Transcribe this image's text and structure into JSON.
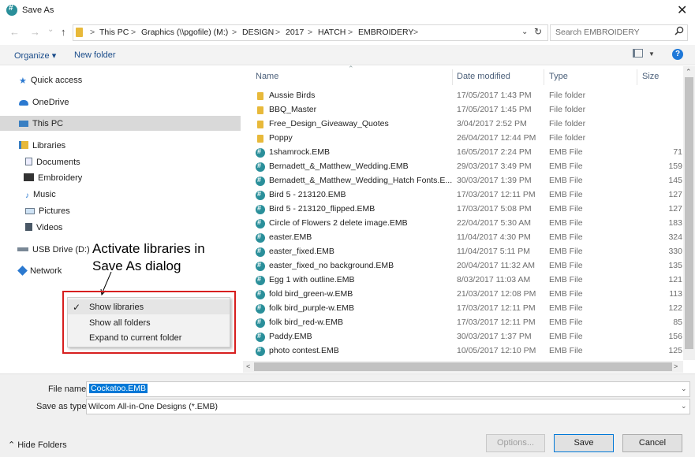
{
  "window": {
    "title": "Save As",
    "close_glyph": "✕"
  },
  "nav": {
    "back": "←",
    "forward": "→",
    "recent": "⌄",
    "up": "↑"
  },
  "address": {
    "crumbs": [
      "This PC",
      "Graphics (\\\\pgofile) (M:)",
      "DESIGN",
      "2017",
      "HATCH",
      "EMBROIDERY"
    ],
    "separator": ">",
    "dropdown": "⌄",
    "refresh": "↻"
  },
  "search": {
    "placeholder": "Search EMBROIDERY",
    "icon": "search-icon"
  },
  "toolbar": {
    "organize": "Organize ▾",
    "new_folder": "New folder",
    "view_dd": "▼",
    "help": "?"
  },
  "sidebar": {
    "items": [
      {
        "label": "Quick access",
        "icon": "star-icon"
      },
      {
        "label": "OneDrive",
        "icon": "cloud-icon"
      },
      {
        "label": "This PC",
        "icon": "pc-icon",
        "selected": true
      },
      {
        "label": "Libraries",
        "icon": "libraries-icon"
      },
      {
        "label": "Documents",
        "icon": "documents-icon"
      },
      {
        "label": "Embroidery",
        "icon": "embroidery-icon"
      },
      {
        "label": "Music",
        "icon": "music-icon"
      },
      {
        "label": "Pictures",
        "icon": "pictures-icon"
      },
      {
        "label": "Videos",
        "icon": "videos-icon"
      },
      {
        "label": "USB Drive (D:)",
        "icon": "usb-icon"
      },
      {
        "label": "Network",
        "icon": "network-icon"
      }
    ]
  },
  "annotation": {
    "text": "Activate libraries in Save As dialog"
  },
  "context_menu": {
    "check": "✓",
    "items": [
      "Show libraries",
      "Show all folders",
      "Expand to current folder"
    ]
  },
  "columns": {
    "name": "Name",
    "date": "Date modified",
    "type": "Type",
    "size": "Size",
    "sort": "⌃"
  },
  "files": [
    {
      "name": "Aussie Birds",
      "date": "17/05/2017 1:43 PM",
      "type": "File folder",
      "size": "",
      "kind": "folder"
    },
    {
      "name": "BBQ_Master",
      "date": "17/05/2017 1:45 PM",
      "type": "File folder",
      "size": "",
      "kind": "folder"
    },
    {
      "name": "Free_Design_Giveaway_Quotes",
      "date": "3/04/2017 2:52 PM",
      "type": "File folder",
      "size": "",
      "kind": "folder"
    },
    {
      "name": "Poppy",
      "date": "26/04/2017 12:44 PM",
      "type": "File folder",
      "size": "",
      "kind": "folder"
    },
    {
      "name": "1shamrock.EMB",
      "date": "16/05/2017 2:24 PM",
      "type": "EMB File",
      "size": "71",
      "kind": "emb"
    },
    {
      "name": "Bernadett_&_Matthew_Wedding.EMB",
      "date": "29/03/2017 3:49 PM",
      "type": "EMB File",
      "size": "159",
      "kind": "emb"
    },
    {
      "name": "Bernadett_&_Matthew_Wedding_Hatch Fonts.E...",
      "date": "30/03/2017 1:39 PM",
      "type": "EMB File",
      "size": "145",
      "kind": "emb"
    },
    {
      "name": "Bird 5 - 213120.EMB",
      "date": "17/03/2017 12:11 PM",
      "type": "EMB File",
      "size": "127",
      "kind": "emb"
    },
    {
      "name": "Bird 5 - 213120_flipped.EMB",
      "date": "17/03/2017 5:08 PM",
      "type": "EMB File",
      "size": "127",
      "kind": "emb"
    },
    {
      "name": "Circle of Flowers 2 delete image.EMB",
      "date": "22/04/2017 5:30 AM",
      "type": "EMB File",
      "size": "183",
      "kind": "emb"
    },
    {
      "name": "easter.EMB",
      "date": "11/04/2017 4:30 PM",
      "type": "EMB File",
      "size": "324",
      "kind": "emb"
    },
    {
      "name": "easter_fixed.EMB",
      "date": "11/04/2017 5:11 PM",
      "type": "EMB File",
      "size": "330",
      "kind": "emb"
    },
    {
      "name": "easter_fixed_no background.EMB",
      "date": "20/04/2017 11:32 AM",
      "type": "EMB File",
      "size": "135",
      "kind": "emb"
    },
    {
      "name": "Egg 1 with outline.EMB",
      "date": "8/03/2017 11:03 AM",
      "type": "EMB File",
      "size": "121",
      "kind": "emb"
    },
    {
      "name": "fold bird_green-w.EMB",
      "date": "21/03/2017 12:08 PM",
      "type": "EMB File",
      "size": "113",
      "kind": "emb"
    },
    {
      "name": "folk bird_purple-w.EMB",
      "date": "17/03/2017 12:11 PM",
      "type": "EMB File",
      "size": "122",
      "kind": "emb"
    },
    {
      "name": "folk bird_red-w.EMB",
      "date": "17/03/2017 12:11 PM",
      "type": "EMB File",
      "size": "85",
      "kind": "emb"
    },
    {
      "name": "Paddy.EMB",
      "date": "30/03/2017 1:37 PM",
      "type": "EMB File",
      "size": "156",
      "kind": "emb"
    },
    {
      "name": "photo contest.EMB",
      "date": "10/05/2017 12:10 PM",
      "type": "EMB File",
      "size": "125",
      "kind": "emb"
    }
  ],
  "form": {
    "file_name_label": "File name:",
    "file_name_value": "Cockatoo.EMB",
    "save_type_label": "Save as type:",
    "save_type_value": "Wilcom All-in-One Designs (*.EMB)",
    "dd": "⌄"
  },
  "footer": {
    "hide_folders": "⌃ Hide Folders",
    "options": "Options...",
    "save": "Save",
    "cancel": "Cancel"
  },
  "scroll": {
    "up": "⌃",
    "left": "<",
    "right": ">"
  }
}
